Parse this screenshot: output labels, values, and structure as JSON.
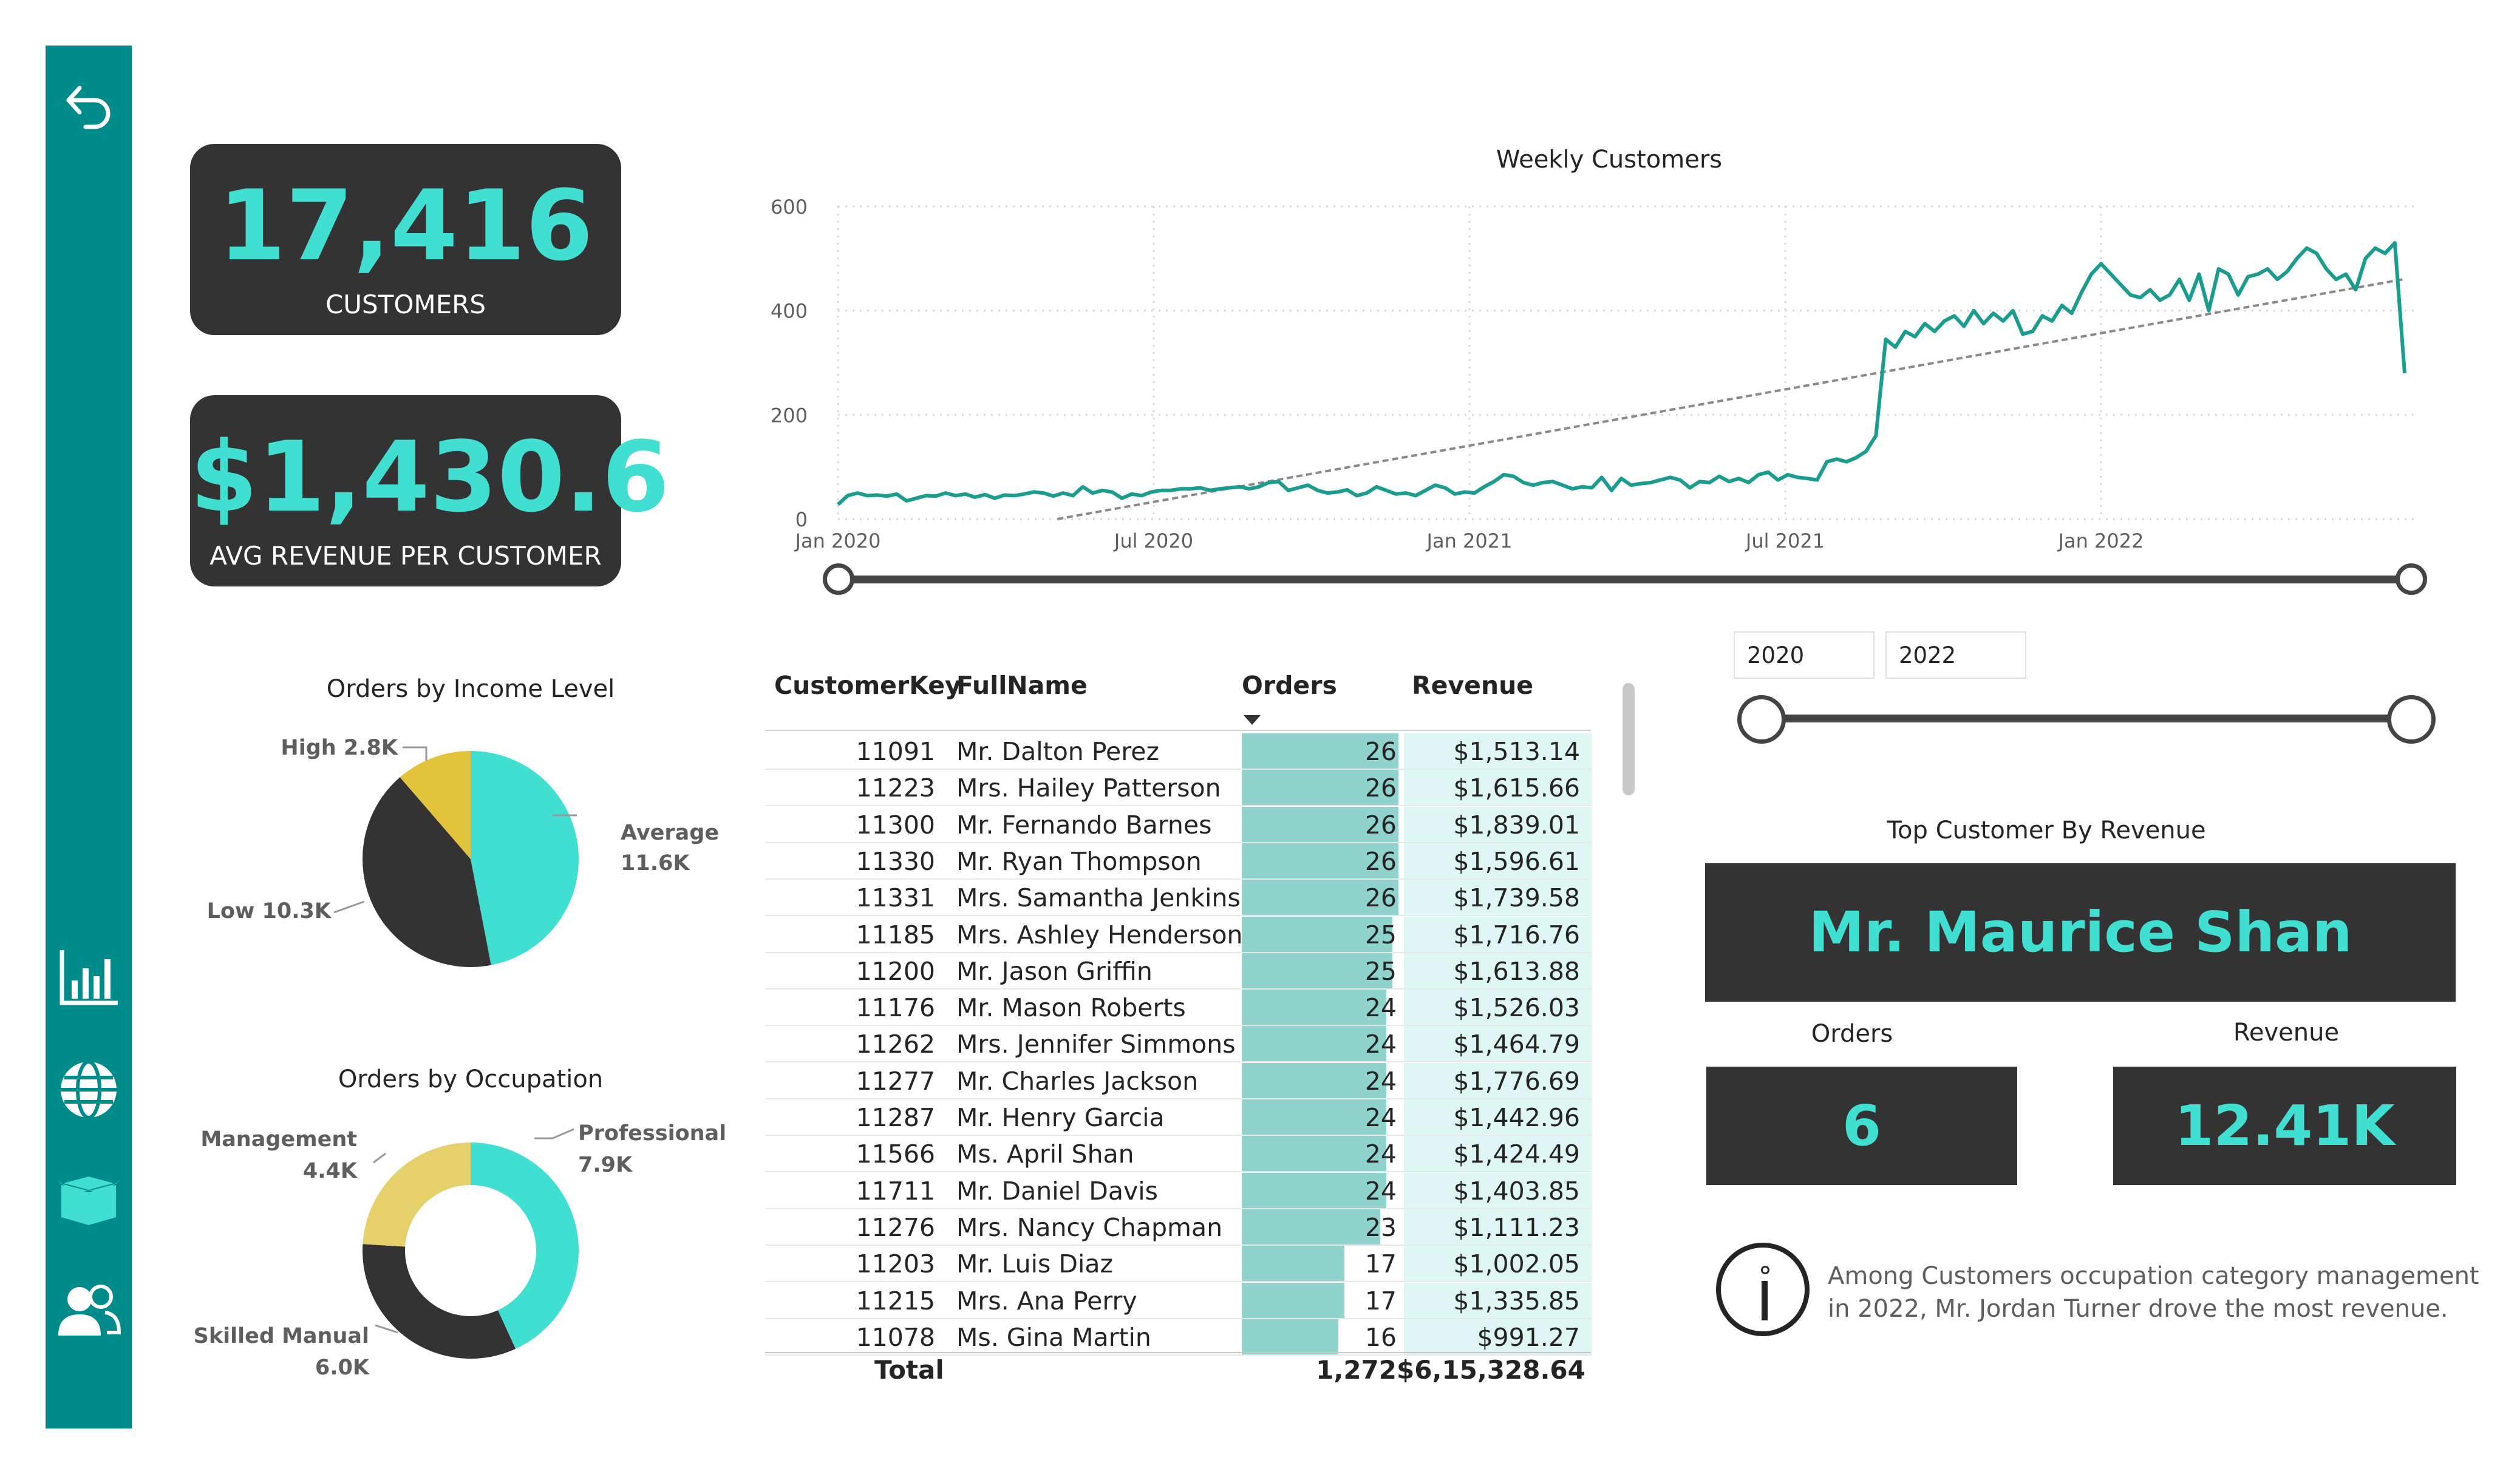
{
  "kpi": {
    "customers_value": "17,416",
    "customers_label": "CUSTOMERS",
    "avg_revenue_value": "$1,430.6",
    "avg_revenue_label": "AVG REVENUE PER CUSTOMER"
  },
  "sidebar": {
    "items": [
      {
        "icon": "back-arrow-icon"
      },
      {
        "icon": "bar-chart-icon"
      },
      {
        "icon": "globe-icon"
      },
      {
        "icon": "box-icon"
      },
      {
        "icon": "users-icon"
      }
    ]
  },
  "weekly_chart": {
    "title": "Weekly Customers",
    "x_ticks": [
      "Jan 2020",
      "Jul 2020",
      "Jan 2021",
      "Jul 2021",
      "Jan 2022"
    ],
    "y_ticks": [
      "0",
      "200",
      "400",
      "600"
    ]
  },
  "chart_data": {
    "type": "line",
    "title": "Weekly Customers",
    "x_range": [
      "2020-01-01",
      "2022-06-30"
    ],
    "ylim": [
      0,
      600
    ],
    "grid": true,
    "series": [
      {
        "values": [
          28,
          45,
          50,
          45,
          46,
          44,
          48,
          35,
          40,
          45,
          44,
          50,
          45,
          48,
          42,
          47,
          40,
          46,
          45,
          48,
          52,
          50,
          44,
          50,
          45,
          62,
          50,
          55,
          52,
          40,
          48,
          45,
          52,
          55,
          55,
          58,
          58,
          60,
          55,
          58,
          60,
          62,
          58,
          62,
          70,
          72,
          55,
          60,
          65,
          55,
          50,
          52,
          56,
          45,
          50,
          62,
          55,
          48,
          50,
          45,
          55,
          65,
          60,
          48,
          52,
          50,
          62,
          72,
          85,
          82,
          70,
          65,
          70,
          72,
          65,
          58,
          62,
          60,
          80,
          55,
          78,
          65,
          68,
          70,
          75,
          80,
          75,
          60,
          72,
          70,
          82,
          72,
          78,
          70,
          85,
          90,
          75,
          85,
          80,
          78,
          75,
          110,
          115,
          110,
          118,
          130,
          160,
          345,
          330,
          360,
          350,
          375,
          360,
          380,
          390,
          370,
          400,
          375,
          395,
          380,
          400,
          355,
          360,
          390,
          380,
          410,
          395,
          435,
          470,
          490,
          470,
          450,
          430,
          425,
          440,
          420,
          430,
          460,
          420,
          470,
          400,
          480,
          470,
          430,
          465,
          470,
          480,
          460,
          475,
          500,
          520,
          510,
          480,
          460,
          470,
          440,
          500,
          520,
          510,
          530,
          280
        ],
        "trendline": [
          [
            0.14,
            0
          ],
          [
            0.999,
            460
          ]
        ]
      }
    ],
    "xlabel": "",
    "ylabel": ""
  },
  "income_pie": {
    "title": "Orders by Income Level",
    "slices": [
      {
        "name": "Average",
        "value_label": "11.6K",
        "value": 11.6,
        "color": "#40dfd2"
      },
      {
        "name": "Low",
        "value_label": "10.3K",
        "value": 10.3,
        "color": "#333333"
      },
      {
        "name": "High",
        "value_label": "2.8K",
        "value": 2.8,
        "color": "#e3c33a"
      }
    ],
    "labels": {
      "average_a": "Average",
      "average_b": "11.6K",
      "low": "Low 10.3K",
      "high": "High 2.8K"
    }
  },
  "occupation_donut": {
    "title": "Orders by Occupation",
    "slices": [
      {
        "name": "Professional",
        "value_label": "7.9K",
        "value": 7.9,
        "color": "#40dfd2"
      },
      {
        "name": "Skilled Manual",
        "value_label": "6.0K",
        "value": 6.0,
        "color": "#333333"
      },
      {
        "name": "Management",
        "value_label": "4.4K",
        "value": 4.4,
        "color": "#e6d06b"
      }
    ],
    "labels": {
      "prof_a": "Professional",
      "prof_b": "7.9K",
      "skilled_a": "Skilled Manual",
      "skilled_b": "6.0K",
      "mgmt_a": "Management",
      "mgmt_b": "4.4K"
    }
  },
  "table": {
    "headers": [
      "CustomerKey",
      "FullName",
      "Orders",
      "Revenue"
    ],
    "rows": [
      {
        "key": "11091",
        "name": "Mr. Dalton Perez",
        "orders": "26",
        "revenue": "$1,513.14"
      },
      {
        "key": "11223",
        "name": "Mrs. Hailey Patterson",
        "orders": "26",
        "revenue": "$1,615.66"
      },
      {
        "key": "11300",
        "name": "Mr. Fernando Barnes",
        "orders": "26",
        "revenue": "$1,839.01"
      },
      {
        "key": "11330",
        "name": "Mr. Ryan Thompson",
        "orders": "26",
        "revenue": "$1,596.61"
      },
      {
        "key": "11331",
        "name": "Mrs. Samantha Jenkins",
        "orders": "26",
        "revenue": "$1,739.58"
      },
      {
        "key": "11185",
        "name": "Mrs. Ashley Henderson",
        "orders": "25",
        "revenue": "$1,716.76"
      },
      {
        "key": "11200",
        "name": "Mr. Jason Griffin",
        "orders": "25",
        "revenue": "$1,613.88"
      },
      {
        "key": "11176",
        "name": "Mr. Mason Roberts",
        "orders": "24",
        "revenue": "$1,526.03"
      },
      {
        "key": "11262",
        "name": "Mrs. Jennifer Simmons",
        "orders": "24",
        "revenue": "$1,464.79"
      },
      {
        "key": "11277",
        "name": "Mr. Charles Jackson",
        "orders": "24",
        "revenue": "$1,776.69"
      },
      {
        "key": "11287",
        "name": "Mr. Henry Garcia",
        "orders": "24",
        "revenue": "$1,442.96"
      },
      {
        "key": "11566",
        "name": "Ms. April Shan",
        "orders": "24",
        "revenue": "$1,424.49"
      },
      {
        "key": "11711",
        "name": "Mr. Daniel Davis",
        "orders": "24",
        "revenue": "$1,403.85"
      },
      {
        "key": "11276",
        "name": "Mrs. Nancy Chapman",
        "orders": "23",
        "revenue": "$1,111.23"
      },
      {
        "key": "11203",
        "name": "Mr. Luis Diaz",
        "orders": "17",
        "revenue": "$1,002.05"
      },
      {
        "key": "11215",
        "name": "Mrs. Ana Perry",
        "orders": "17",
        "revenue": "$1,335.85"
      },
      {
        "key": "11078",
        "name": "Ms. Gina Martin",
        "orders": "16",
        "revenue": "$991.27"
      }
    ],
    "total_label": "Total",
    "total_orders": "1,272",
    "total_revenue": "$6,15,328.64"
  },
  "year_filter": {
    "start": "2020",
    "end": "2022"
  },
  "top_customer": {
    "title": "Top Customer By Revenue",
    "name": "Mr. Maurice Shan",
    "orders_label": "Orders",
    "orders_value": "6",
    "revenue_label": "Revenue",
    "revenue_value": "12.41K"
  },
  "insight": {
    "line1": "Among Customers occupation category management",
    "line2": "in 2022, Mr. Jordan Turner drove the most revenue."
  }
}
